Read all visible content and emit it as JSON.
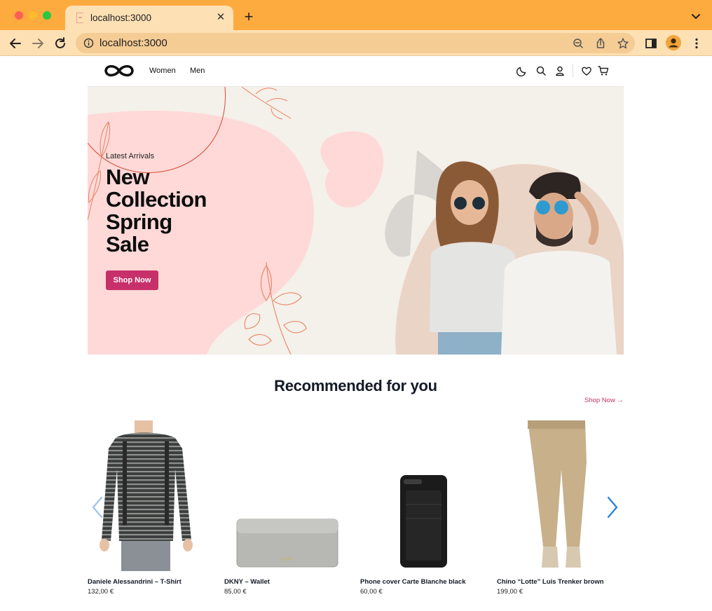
{
  "browser": {
    "tab_title": "localhost:3000",
    "url": "localhost:3000",
    "accent": "#fdaa3f"
  },
  "header": {
    "logo_icon": "infinity-logo",
    "nav": [
      {
        "label": "Women"
      },
      {
        "label": "Men"
      }
    ],
    "icons": [
      "moon-icon",
      "search-icon",
      "user-icon",
      "heart-icon",
      "cart-icon"
    ]
  },
  "hero": {
    "subtitle": "Latest Arrivals",
    "title_lines": [
      "New",
      "Collection",
      "Spring",
      "Sale"
    ],
    "button_label": "Shop Now",
    "button_color": "#c8306a"
  },
  "recommended": {
    "title": "Recommended for you",
    "link_label": "Shop Now →",
    "products": [
      {
        "name": "Daniele Alessandrini – T-Shirt",
        "price": "132,00 €"
      },
      {
        "name": "DKNY – Wallet",
        "price": "85,00 €"
      },
      {
        "name": "Phone cover Carte Blanche black",
        "price": "60,00 €"
      },
      {
        "name": "Chino “Lotte” Luis Trenker brown",
        "price": "199,00 €"
      }
    ]
  }
}
